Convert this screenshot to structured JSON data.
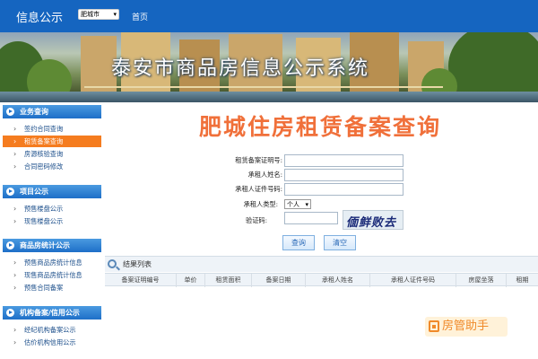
{
  "header": {
    "site_title": "信息公示",
    "city_select": "肥城市",
    "home_link": "首页"
  },
  "banner": {
    "title": "泰安市商品房信息公示系统"
  },
  "sidebar": {
    "sections": [
      {
        "title": "业务查询",
        "items": [
          "签约合同查询",
          "租赁备案查询",
          "房源核验查询",
          "合同密码修改"
        ]
      },
      {
        "title": "项目公示",
        "items": [
          "预售楼盘公示",
          "现售楼盘公示"
        ]
      },
      {
        "title": "商品房统计公示",
        "items": [
          "预售商品房统计信息",
          "现售商品房统计信息",
          "预售合同备案"
        ]
      },
      {
        "title": "机构备案/信用公示",
        "items": [
          "经纪机构备案公示",
          "估价机构信用公示"
        ]
      }
    ],
    "active_item": "租赁备案查询"
  },
  "main": {
    "title": "肥城住房租赁备案查询",
    "form": {
      "cert_no_label": "租赁备案证明号:",
      "lessee_name_label": "承租人姓名:",
      "lessee_id_label": "承租人证件号码:",
      "lessee_type_label": "承租人类型:",
      "lessee_type_value": "个人",
      "captcha_label": "验证码:",
      "captcha_text": "偭鲜败去"
    },
    "buttons": {
      "query": "查询",
      "clear": "清空"
    },
    "results": {
      "title": "结果列表",
      "columns": [
        "备案证明编号",
        "单价",
        "租赁面积",
        "备案日期",
        "承租人姓名",
        "承租人证件号码",
        "房屋坐落",
        "租期"
      ]
    }
  },
  "watermark": {
    "text": "房管助手"
  },
  "colors": {
    "header_bg": "#1565c0",
    "active_nav": "#f57c1f",
    "title_orange": "#f0703a"
  }
}
